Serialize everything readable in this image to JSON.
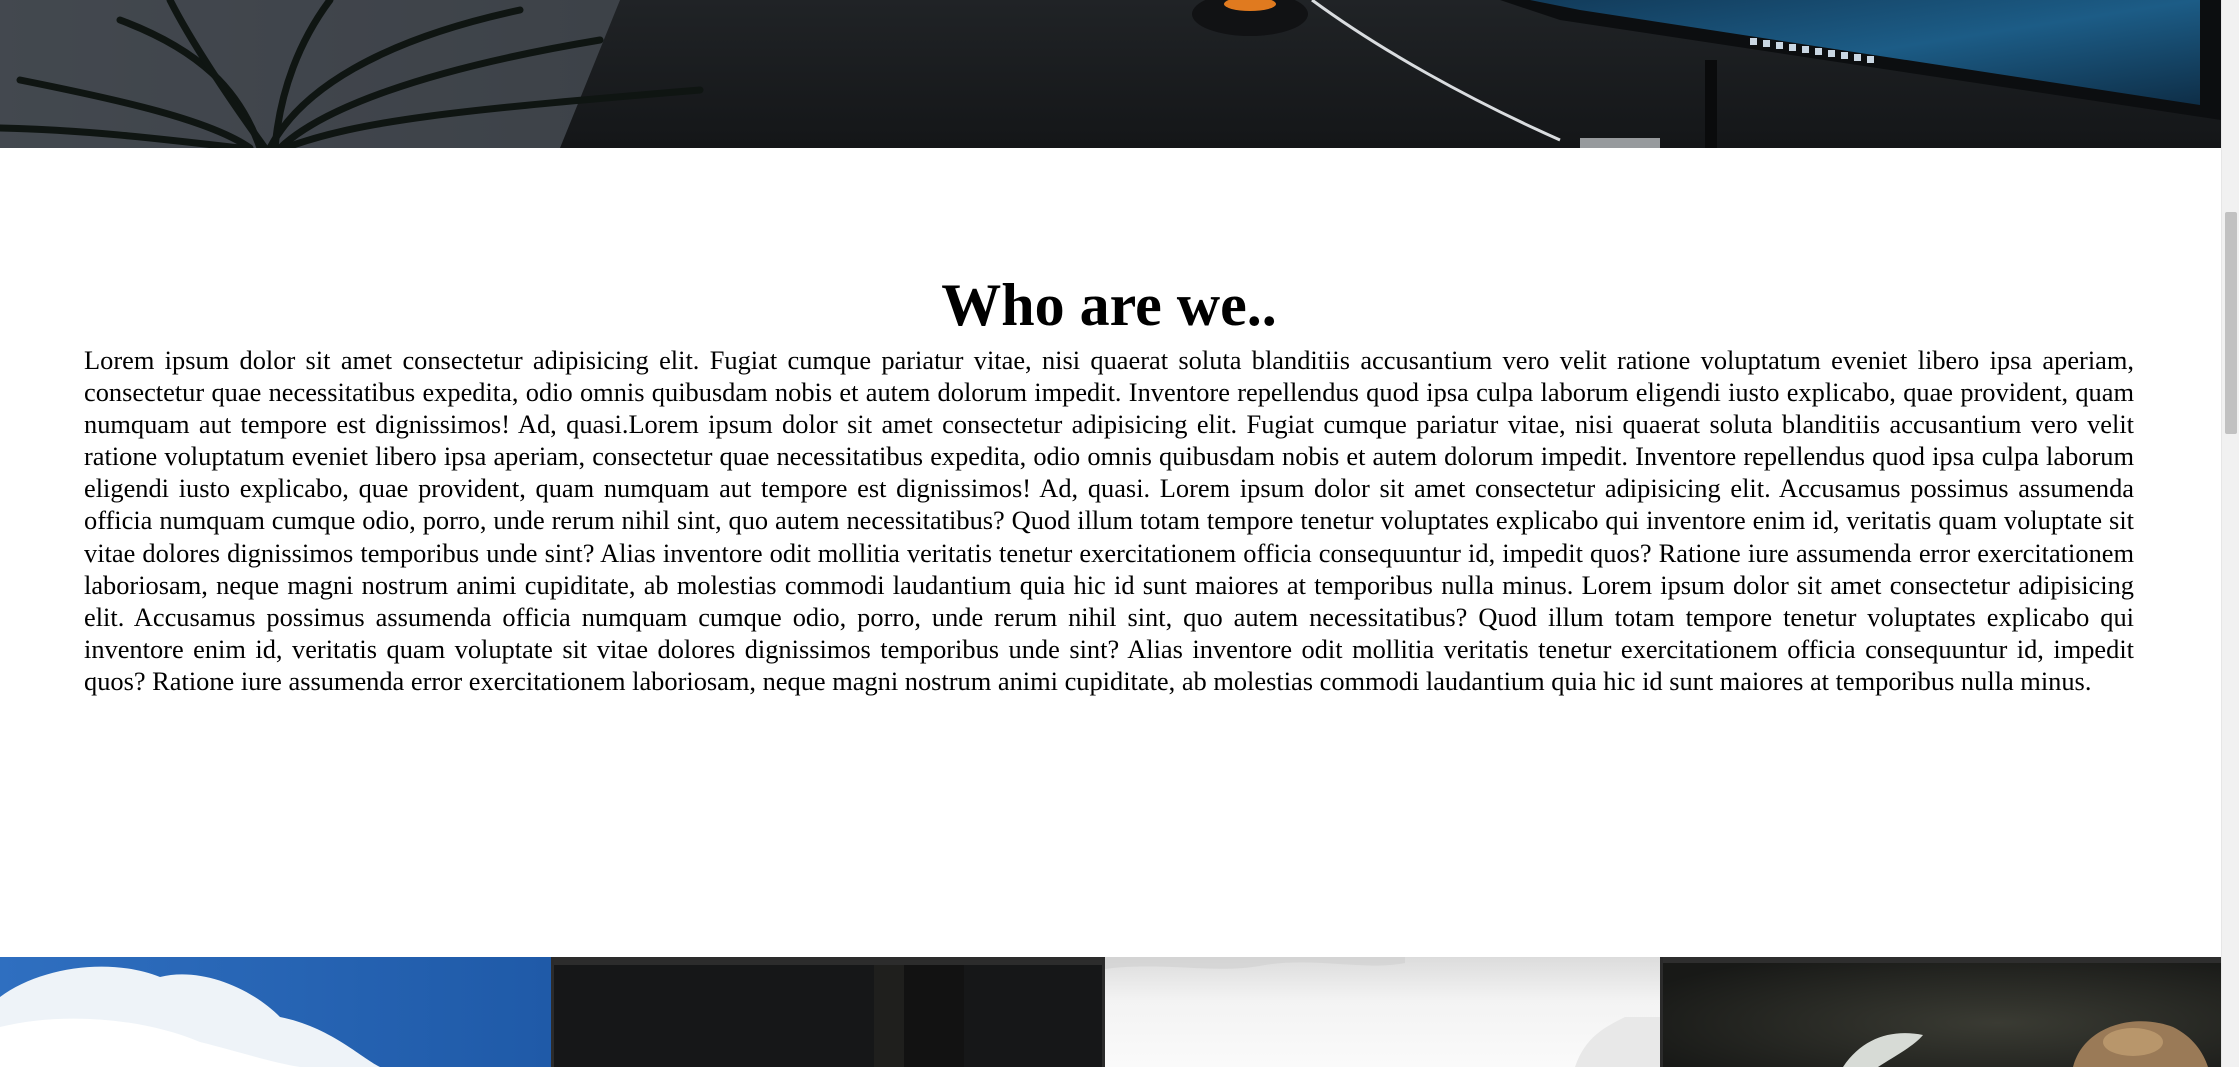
{
  "about": {
    "heading": "Who are we..",
    "body": "Lorem ipsum dolor sit amet consectetur adipisicing elit. Fugiat cumque pariatur vitae, nisi quaerat soluta blanditiis accusantium vero velit ratione voluptatum eveniet libero ipsa aperiam, consectetur quae necessitatibus expedita, odio omnis quibusdam nobis et autem dolorum impedit. Inventore repellendus quod ipsa culpa laborum eligendi iusto explicabo, quae provident, quam numquam aut tempore est dignissimos! Ad, quasi.Lorem ipsum dolor sit amet consectetur adipisicing elit. Fugiat cumque pariatur vitae, nisi quaerat soluta blanditiis accusantium vero velit ratione voluptatum eveniet libero ipsa aperiam, consectetur quae necessitatibus expedita, odio omnis quibusdam nobis et autem dolorum impedit. Inventore repellendus quod ipsa culpa laborum eligendi iusto explicabo, quae provident, quam numquam aut tempore est dignissimos! Ad, quasi. Lorem ipsum dolor sit amet consectetur adipisicing elit. Accusamus possimus assumenda officia numquam cumque odio, porro, unde rerum nihil sint, quo autem necessitatibus? Quod illum totam tempore tenetur voluptates explicabo qui inventore enim id, veritatis quam voluptate sit vitae dolores dignissimos temporibus unde sint? Alias inventore odit mollitia veritatis tenetur exercitationem officia consequuntur id, impedit quos? Ratione iure assumenda error exercitationem laboriosam, neque magni nostrum animi cupiditate, ab molestias commodi laudantium quia hic id sunt maiores at temporibus nulla minus. Lorem ipsum dolor sit amet consectetur adipisicing elit. Accusamus possimus assumenda officia numquam cumque odio, porro, unde rerum nihil sint, quo autem necessitatibus? Quod illum totam tempore tenetur voluptates explicabo qui inventore enim id, veritatis quam voluptate sit vitae dolores dignissimos temporibus unde sint? Alias inventore odit mollitia veritatis tenetur exercitationem officia consequuntur id, impedit quos? Ratione iure assumenda error exercitationem laboriosam, neque magni nostrum animi cupiditate, ab molestias commodi laudantium quia hic id sunt maiores at temporibus nulla minus."
  },
  "hero": {
    "image": "desk-workspace-photo"
  },
  "gallery": {
    "tiles": [
      {
        "image": "sky-clouds-photo"
      },
      {
        "image": "dark-photo"
      },
      {
        "image": "white-misty-photo"
      },
      {
        "image": "dark-object-photo"
      }
    ]
  },
  "colors": {
    "page_background": "#ffffff",
    "text": "#000000",
    "hero_dark": "#1b1d1f",
    "sky_blue": "#2f6fc0",
    "scrollbar_track": "#f1f1f1",
    "scrollbar_thumb": "#c1c1c1"
  }
}
